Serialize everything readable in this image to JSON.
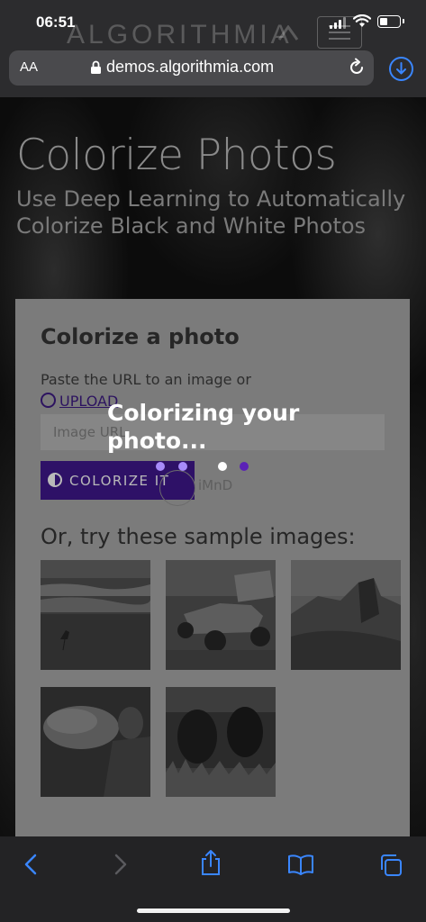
{
  "status_bar": {
    "time": "06:51"
  },
  "site_header": {
    "logo": "ALGORITHMIA"
  },
  "browser": {
    "text_size_label": "AA",
    "domain": "demos.algorithmia.com"
  },
  "hero": {
    "title": "Colorize Photos",
    "subtitle": "Use Deep Learning to Automatically Colorize Black and White Photos"
  },
  "card": {
    "title": "Colorize a photo",
    "instruction": "Paste the URL to an image or",
    "upload_label": "UPLOAD",
    "url_placeholder": "Image URL",
    "colorize_button": "COLORIZE IT",
    "ghost_label": "iMnD",
    "samples_heading": "Or, try these sample images:"
  },
  "overlay": {
    "message": "Colorizing your photo...",
    "dot_colors": [
      "#a78bfa",
      "#a78bfa",
      "#ffffff",
      "#5b21b6"
    ]
  },
  "samples": [
    {
      "icon": "beach-bird-photo"
    },
    {
      "icon": "race-car-photo"
    },
    {
      "icon": "half-dome-photo"
    },
    {
      "icon": "smoke-person-photo"
    },
    {
      "icon": "cattle-photo"
    }
  ],
  "toolbar_icons": [
    "back-icon",
    "forward-icon",
    "share-icon",
    "bookmarks-icon",
    "tabs-icon"
  ],
  "colors": {
    "accent": "#3a86ff",
    "button_bg": "#2e1167"
  }
}
